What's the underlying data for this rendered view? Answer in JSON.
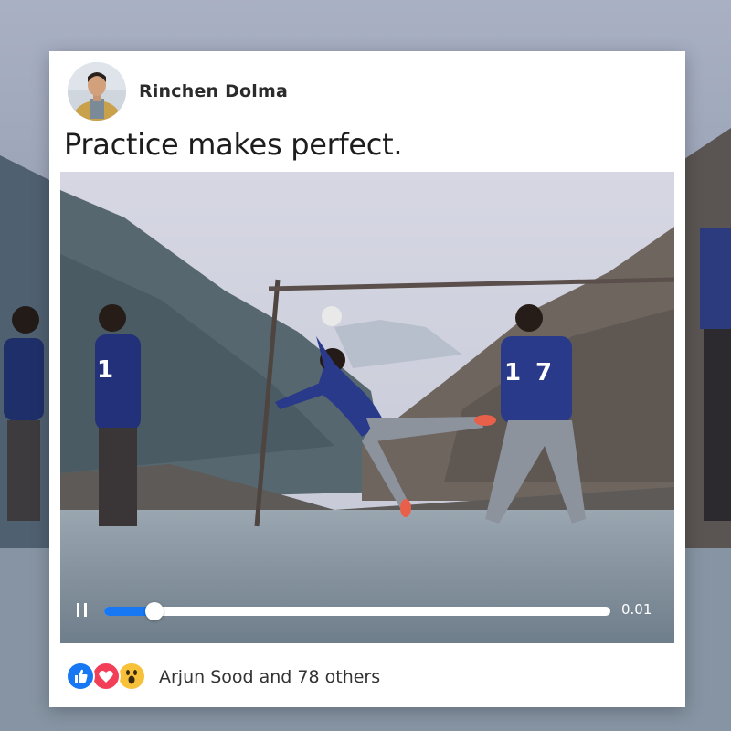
{
  "post": {
    "author": "Rinchen Dolma",
    "caption": "Practice makes perfect."
  },
  "video": {
    "state": "playing",
    "progress_fraction": 0.1,
    "time": "0.01",
    "accent_color": "#1877f2"
  },
  "reactions": {
    "icons": [
      "like-icon",
      "love-icon",
      "wow-icon"
    ],
    "summary": "Arjun Sood and 78 others"
  }
}
